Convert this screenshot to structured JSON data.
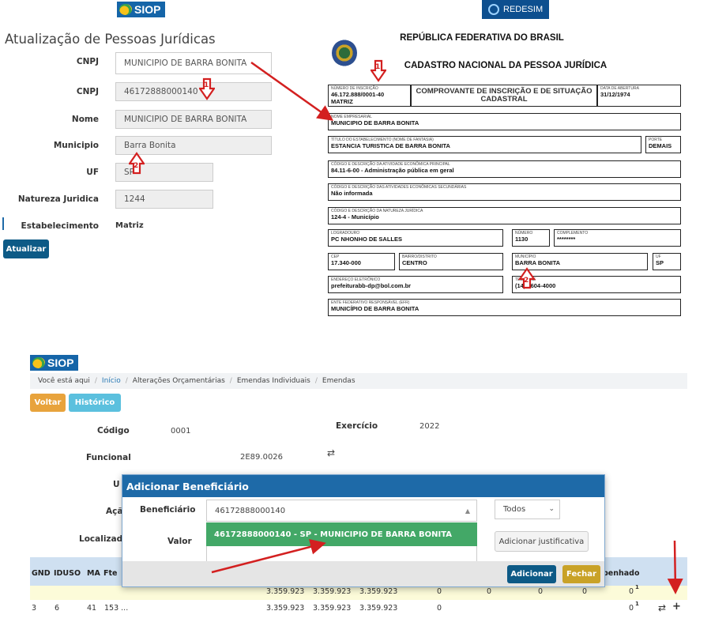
{
  "top_left": {
    "logo": "SIOP",
    "title": "Atualização de Pessoas Jurídicas",
    "fields": [
      {
        "label": "CNPJ",
        "value": "MUNICIPIO DE BARRA BONITA"
      },
      {
        "label": "CNPJ",
        "value": "46172888000140"
      },
      {
        "label": "Nome",
        "value": "MUNICIPIO DE BARRA BONITA"
      },
      {
        "label": "Municipio",
        "value": "Barra Bonita"
      },
      {
        "label": "UF",
        "value": "SP"
      },
      {
        "label": "Natureza Juridica",
        "value": "1244"
      },
      {
        "label": "Estabelecimento",
        "value": "Matriz"
      }
    ],
    "update_button": "Atualizar",
    "marker_1": "1",
    "marker_2": "2"
  },
  "receipt": {
    "logo": "REDESIM",
    "header1": "REPÚBLICA FEDERATIVA DO BRASIL",
    "header2": "CADASTRO NACIONAL DA PESSOA JURÍDICA",
    "marker_1": "1",
    "marker_2": "2",
    "insc_cap": "NÚMERO DE INSCRIÇÃO",
    "insc_val": "46.172.888/0001-40",
    "insc_val2": "MATRIZ",
    "comp_title": "COMPROVANTE DE INSCRIÇÃO E DE SITUAÇÃO CADASTRAL",
    "abert_cap": "DATA DE ABERTURA",
    "abert_val": "31/12/1974",
    "nome_cap": "NOME EMPRESARIAL",
    "nome_val": "MUNICIPIO DE BARRA BONITA",
    "fant_cap": "TÍTULO DO ESTABELECIMENTO (NOME DE FANTASIA)",
    "fant_val": "ESTANCIA TURISTICA DE BARRA BONITA",
    "porte_cap": "PORTE",
    "porte_val": "DEMAIS",
    "ativ_cap": "CÓDIGO E DESCRIÇÃO DA ATIVIDADE ECONÔMICA PRINCIPAL",
    "ativ_val": "84.11-6-00 - Administração pública em geral",
    "sec_cap": "CÓDIGO E DESCRIÇÃO DAS ATIVIDADES ECONÔMICAS SECUNDÁRIAS",
    "sec_val": "Não informada",
    "nat_cap": "CÓDIGO E DESCRIÇÃO DA NATUREZA JURÍDICA",
    "nat_val": "124-4 - Município",
    "log_cap": "LOGRADOURO",
    "log_val": "PC NHONHO DE SALLES",
    "num_cap": "NÚMERO",
    "num_val": "1130",
    "comp_cap": "COMPLEMENTO",
    "comp_val": "********",
    "cep_cap": "CEP",
    "cep_val": "17.340-000",
    "bairro_cap": "BAIRRO/DISTRITO",
    "bairro_val": "CENTRO",
    "mun_cap": "MUNICÍPIO",
    "mun_val": "BARRA BONITA",
    "uf_cap": "UF",
    "uf_val": "SP",
    "email_cap": "ENDEREÇO ELETRÔNICO",
    "email_val": "prefeiturabb-dp@bol.com.br",
    "tel_cap": "TELEFONE",
    "tel_val": "(14) 3604-4000",
    "efr_cap": "ENTE FEDERATIVO RESPONSÁVEL (EFR)",
    "efr_val": "MUNICÍPIO DE BARRA BONITA"
  },
  "bottom": {
    "logo": "SIOP",
    "breadcrumb": [
      "Você está aqui",
      "Início",
      "Alterações Orçamentárias",
      "Emendas Individuais",
      "Emendas"
    ],
    "voltar": "Voltar",
    "historico": "Histórico",
    "codigo_label": "Código",
    "codigo_value": "0001",
    "exercicio_label": "Exercício",
    "exercicio_value": "2022",
    "funcional_label": "Funcional",
    "funcional_value": "2E89.0026",
    "swap_icon": "⇄",
    "uo_label": "U",
    "acao_label": "Açã",
    "localizador_label": "Localizad",
    "table_header": [
      "GND",
      "IDUSO",
      "MA",
      "Fte"
    ],
    "empenhado_label": "penhado",
    "row1": {
      "v1": "3.359.923",
      "v2": "3.359.923",
      "v3": "3.359.923",
      "z1": "0",
      "z2": "0",
      "z3": "0",
      "z4": "0",
      "z5": "0",
      "sup": "1"
    },
    "row2": {
      "gnd": "3",
      "iduso": "6",
      "ma": "41",
      "fte": "153 ...",
      "v1": "3.359.923",
      "v2": "3.359.923",
      "v3": "3.359.923",
      "z1": "0",
      "z5": "0",
      "sup": "1",
      "swap": "⇄",
      "plus": "+"
    }
  },
  "modal": {
    "title": "Adicionar Beneficiário",
    "beneficiario_label": "Beneficiário",
    "beneficiario_value": "46172888000140",
    "dropdown_option": "46172888000140  -  SP  -  MUNICIPIO DE BARRA BONITA",
    "todos": "Todos",
    "valor_label": "Valor",
    "justificativa_button": "Adicionar justificativa",
    "adicionar_button": "Adicionar",
    "fechar_button": "Fechar"
  },
  "colors": {
    "annotation_red": "#d32020",
    "siop_blue": "#1565a8",
    "modal_header": "#1e6aa8",
    "dropdown_green": "#43a867"
  }
}
